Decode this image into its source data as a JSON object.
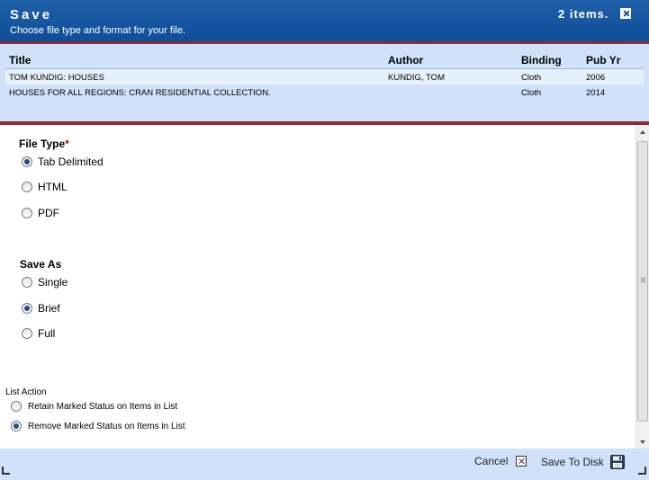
{
  "header": {
    "title": "Save",
    "subtitle": "Choose file type and format for your file.",
    "item_count": "2 items."
  },
  "table": {
    "columns": [
      "Title",
      "Author",
      "Binding",
      "Pub Yr"
    ],
    "rows": [
      {
        "title": "TOM KUNDIG: HOUSES",
        "author": "KUNDIG, TOM",
        "binding": "Cloth",
        "pub_yr": "2006"
      },
      {
        "title": "HOUSES FOR ALL REGIONS: CRAN RESIDENTIAL COLLECTION.",
        "author": "",
        "binding": "Cloth",
        "pub_yr": "2014"
      }
    ]
  },
  "file_type": {
    "label": "File Type",
    "required_mark": "*",
    "options": [
      {
        "label": "Tab Delimited",
        "checked": true
      },
      {
        "label": "HTML",
        "checked": false
      },
      {
        "label": "PDF",
        "checked": false
      }
    ]
  },
  "save_as": {
    "label": "Save As",
    "options": [
      {
        "label": "Single",
        "checked": false
      },
      {
        "label": "Brief",
        "checked": true
      },
      {
        "label": "Full",
        "checked": false
      }
    ]
  },
  "list_action": {
    "label": "List Action",
    "options": [
      {
        "label": "Retain Marked Status on Items in List",
        "checked": false
      },
      {
        "label": "Remove Marked Status on Items in List",
        "checked": true
      }
    ]
  },
  "footer": {
    "cancel_label": "Cancel",
    "save_label": "Save To Disk"
  },
  "colors": {
    "header_blue": "#0f4f9a",
    "accent_maroon": "#8a2a3a",
    "panel_blue": "#cfe2fa"
  }
}
